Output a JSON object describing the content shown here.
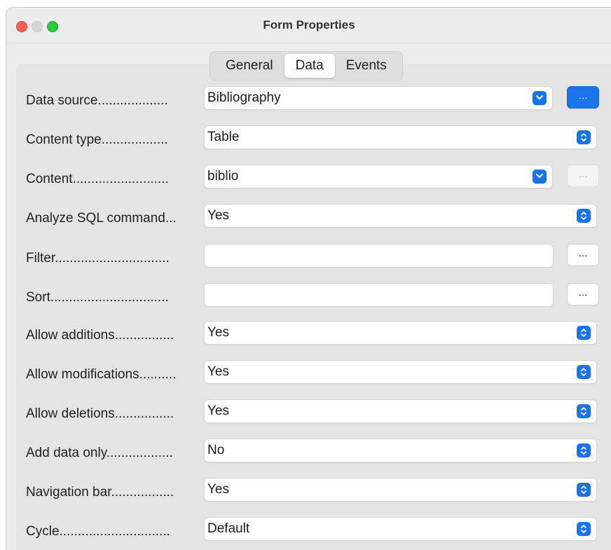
{
  "window": {
    "title": "Form Properties"
  },
  "tabs": [
    {
      "label": "General",
      "active": false
    },
    {
      "label": "Data",
      "active": true
    },
    {
      "label": "Events",
      "active": false
    }
  ],
  "rows": {
    "data_source": {
      "label": "Data source...................",
      "value": "Bibliography",
      "button": "..."
    },
    "content_type": {
      "label": "Content type..................",
      "value": "Table"
    },
    "content": {
      "label": "Content..........................",
      "value": "biblio",
      "button": "..."
    },
    "analyze_sql": {
      "label": "Analyze SQL command...",
      "value": "Yes"
    },
    "filter": {
      "label": "Filter...............................",
      "value": "",
      "button": "..."
    },
    "sort": {
      "label": "Sort................................",
      "value": "",
      "button": "..."
    },
    "allow_additions": {
      "label": "Allow additions................",
      "value": "Yes"
    },
    "allow_modifications": {
      "label": "Allow modifications..........",
      "value": "Yes"
    },
    "allow_deletions": {
      "label": "Allow deletions................",
      "value": "Yes"
    },
    "add_data_only": {
      "label": "Add data only..................",
      "value": "No"
    },
    "navigation_bar": {
      "label": "Navigation bar.................",
      "value": "Yes"
    },
    "cycle": {
      "label": "Cycle..............................",
      "value": "Default"
    }
  },
  "colors": {
    "accent": "#1a73e8",
    "close": "#ff5f57",
    "zoom": "#2ac941"
  }
}
